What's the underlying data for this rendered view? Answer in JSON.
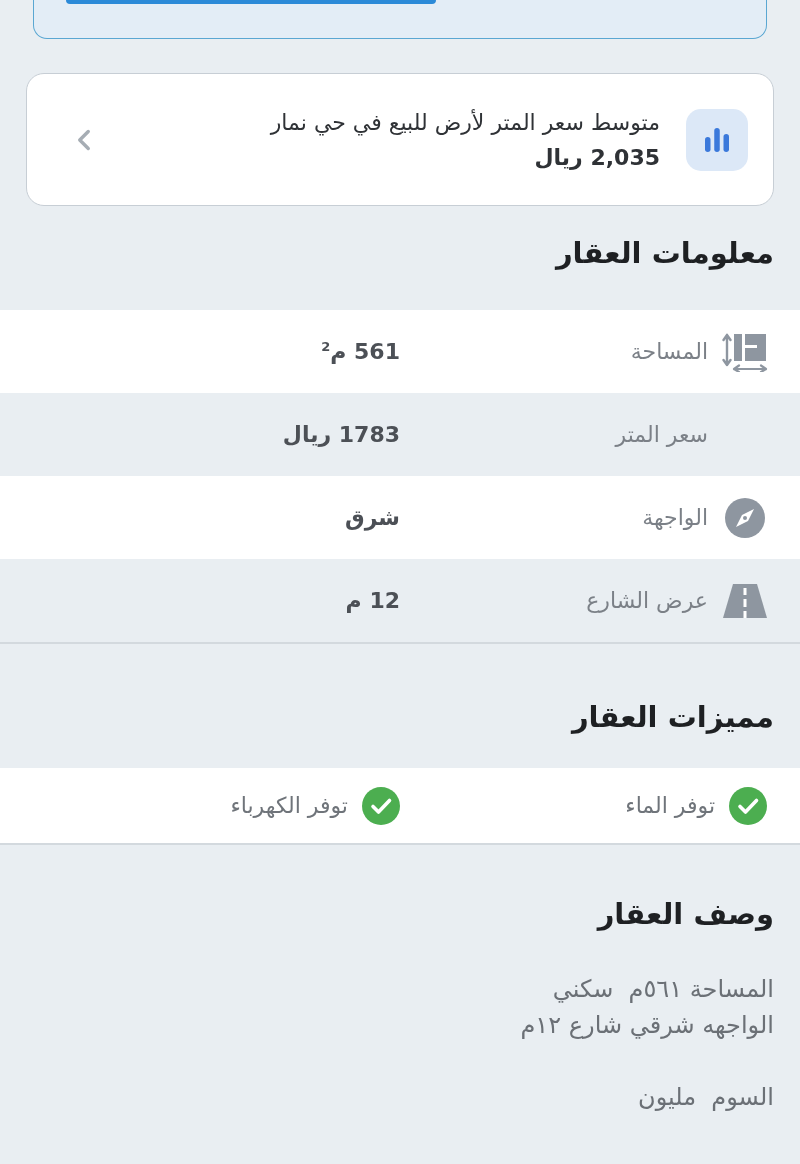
{
  "price_insight": {
    "title": "متوسط سعر المتر لأرض للبيع في حي نمار",
    "value": "2,035 ريال"
  },
  "details": {
    "heading": "معلومات العقار",
    "rows": [
      {
        "kind": "area",
        "label": "المساحة",
        "value": "561 م$^{2}$"
      },
      {
        "kind": "price",
        "label": "سعر المتر",
        "value": "1783 ريال"
      },
      {
        "kind": "facing",
        "label": "الواجهة",
        "value": "شرق"
      },
      {
        "kind": "street",
        "label": "عرض الشارع",
        "value": "12 م"
      }
    ]
  },
  "features": {
    "heading": "مميزات العقار",
    "items": [
      {
        "label": "توفر الماء"
      },
      {
        "label": "توفر الكهرباء"
      }
    ]
  },
  "description": {
    "heading": "وصف العقار",
    "paragraphs": [
      "المساحة ٥٦١م  سكني\nالواجهه شرقي شارع ١٢م",
      "السوم  مليون"
    ]
  }
}
